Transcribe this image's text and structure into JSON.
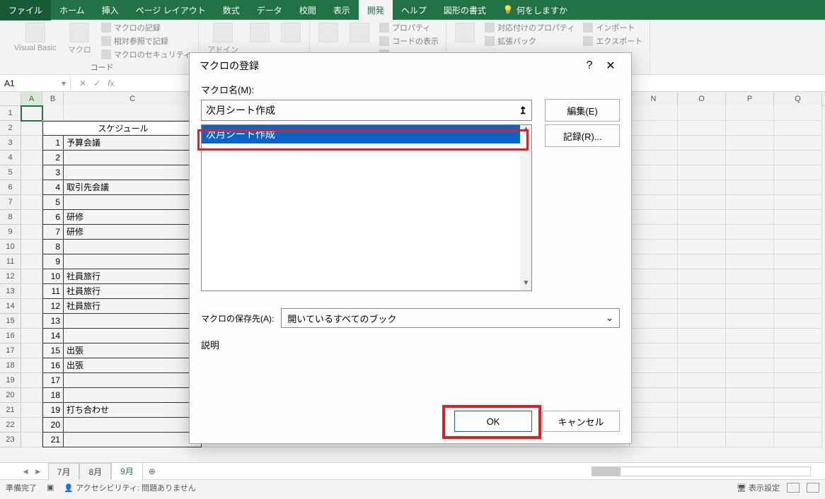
{
  "tabs": {
    "file": "ファイル",
    "home": "ホーム",
    "insert": "挿入",
    "pageLayout": "ページ レイアウト",
    "formulas": "数式",
    "data": "データ",
    "review": "校閲",
    "view": "表示",
    "developer": "開発",
    "help": "ヘルプ",
    "shapeFormat": "図形の書式",
    "tellMe": "何をしますか"
  },
  "ribbon": {
    "vb": "Visual Basic",
    "macro": "マクロ",
    "recordMacro": "マクロの記録",
    "relativeRef": "相対参照で記録",
    "macroSecurity": "マクロのセキュリティ",
    "codeGroup": "コード",
    "addins": "アドイン",
    "properties": "プロパティ",
    "viewCode": "コードの表示",
    "mapProps": "対応付けのプロパティ",
    "expansion": "拡張パック",
    "import": "インポート",
    "export": "エクスポート"
  },
  "nameBox": "A1",
  "columns": [
    "A",
    "B",
    "C"
  ],
  "rightColumns": [
    "N",
    "O",
    "P",
    "Q"
  ],
  "sheet": {
    "header": "スケジュール",
    "rows": [
      {
        "n": "1",
        "t": "予算会議"
      },
      {
        "n": "2",
        "t": ""
      },
      {
        "n": "3",
        "t": ""
      },
      {
        "n": "4",
        "t": "取引先会議"
      },
      {
        "n": "5",
        "t": ""
      },
      {
        "n": "6",
        "t": "研修"
      },
      {
        "n": "7",
        "t": "研修"
      },
      {
        "n": "8",
        "t": ""
      },
      {
        "n": "9",
        "t": ""
      },
      {
        "n": "10",
        "t": "社員旅行"
      },
      {
        "n": "11",
        "t": "社員旅行"
      },
      {
        "n": "12",
        "t": "社員旅行"
      },
      {
        "n": "13",
        "t": ""
      },
      {
        "n": "14",
        "t": ""
      },
      {
        "n": "15",
        "t": "出張"
      },
      {
        "n": "16",
        "t": "出張"
      },
      {
        "n": "17",
        "t": ""
      },
      {
        "n": "18",
        "t": ""
      },
      {
        "n": "19",
        "t": "打ち合わせ"
      },
      {
        "n": "20",
        "t": ""
      },
      {
        "n": "21",
        "t": ""
      }
    ]
  },
  "sheetTabs": {
    "t1": "7月",
    "t2": "8月",
    "t3": "9月"
  },
  "status": {
    "ready": "準備完了",
    "acc": "アクセシビリティ: 問題ありません",
    "displaySettings": "表示設定"
  },
  "dialog": {
    "title": "マクロの登録",
    "macroNameLabel": "マクロ名(M):",
    "macroName": "次月シート作成",
    "listItem": "次月シート作成",
    "edit": "編集(E)",
    "record": "記録(R)...",
    "saveLabel": "マクロの保存先(A):",
    "saveValue": "開いているすべてのブック",
    "descLabel": "説明",
    "ok": "OK",
    "cancel": "キャンセル"
  }
}
